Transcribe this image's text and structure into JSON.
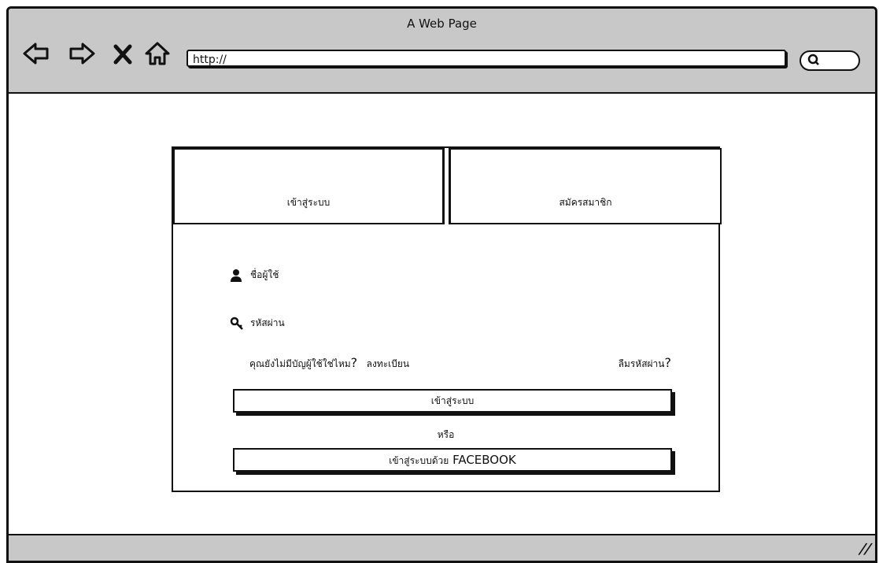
{
  "browser": {
    "title": "A Web Page",
    "url": "http://"
  },
  "tabs": [
    {
      "label": "เข้าสู่ระบบ"
    },
    {
      "label": "สมัครสมาชิก"
    }
  ],
  "form": {
    "username_label": "ชื่อผู้ใช้",
    "password_label": "รหัสผ่าน",
    "no_account_text": "คุณยังไม่มีบัญผู้ใช้ใช่ไหม",
    "question_mark": "?",
    "register_link": "ลงทะเบียน",
    "forgot_password": "ลืมรหัสผ่าน",
    "login_button": "เข้าสู่ระบบ",
    "or_text": "หรือ",
    "facebook_button_prefix": "เข้าสู่ระบบด้วย",
    "facebook_button_brand": "FACEBOOK"
  },
  "icons": {
    "back": "back-arrow-icon",
    "forward": "forward-arrow-icon",
    "stop": "close-icon",
    "home": "home-icon",
    "search": "search-icon",
    "user": "user-icon",
    "key": "key-icon",
    "resize": "resize-grip-icon"
  }
}
